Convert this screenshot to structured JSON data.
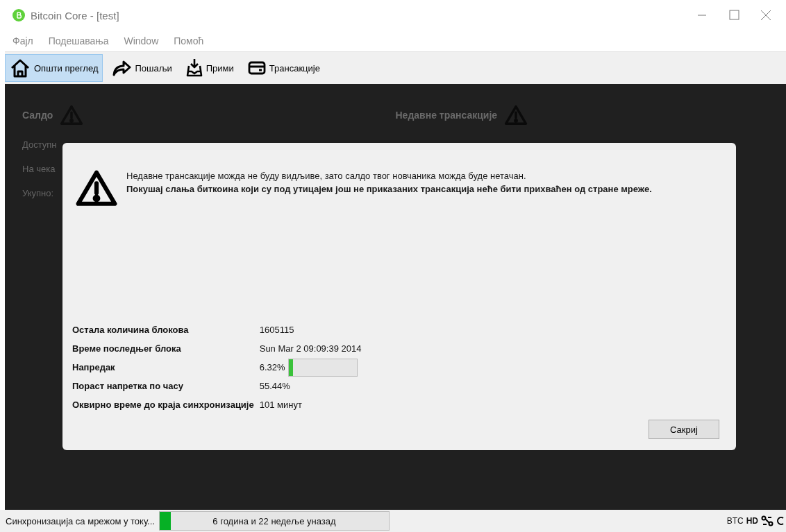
{
  "window": {
    "title": "Bitcoin Core - [test]"
  },
  "menu": [
    "Фајл",
    "Подешавања",
    "Window",
    "Помоћ"
  ],
  "toolbar": [
    {
      "label": "Општи преглед",
      "selected": true
    },
    {
      "label": "Пошаљи",
      "selected": false
    },
    {
      "label": "Прими",
      "selected": false
    },
    {
      "label": "Трансакције",
      "selected": false
    }
  ],
  "overview": {
    "balance_title": "Салдо",
    "recent_title": "Недавне трансакције",
    "rows": [
      "Доступн",
      "На чека",
      "Укупно:"
    ]
  },
  "dialog": {
    "message": "Недавне трансакције можда не буду видљиве, зато салдо твог новчаника можда буде нетачан.",
    "warning": "Покушај слања биткоина који су под утицајем још не приказаних трансакција неће бити прихваћен од стране мреже.",
    "stats": [
      {
        "label": "Остала количина блокова",
        "value": "1605115"
      },
      {
        "label": "Време последњег блока",
        "value": "Sun Mar 2 09:09:39 2014"
      },
      {
        "label": "Напредак",
        "value": "6.32%",
        "level": 0.0632
      },
      {
        "label": "Пораст напретка по часу",
        "value": "55.44%"
      },
      {
        "label": "Оквирно време до краја синхронизације",
        "value": "101 минут"
      }
    ],
    "button": "Сакриј"
  },
  "status_bar": {
    "text": "Синхронизација са мрежом у току...",
    "progress_text": "6 година и 22 недеље уназад",
    "level": 0.05,
    "unit": "BTC",
    "hd": "HD"
  }
}
